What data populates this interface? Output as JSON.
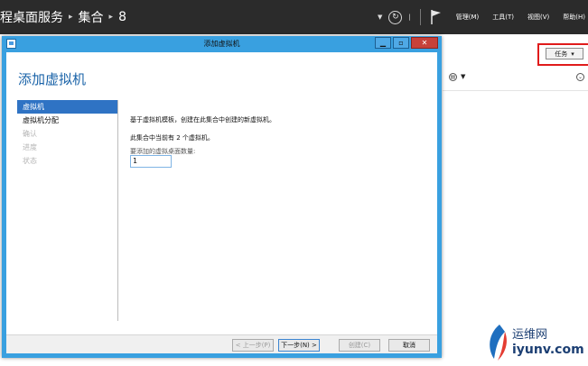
{
  "header": {
    "breadcrumb": [
      "程桌面服务",
      "集合",
      "8"
    ],
    "menus": [
      "管理(M)",
      "工具(T)",
      "视图(V)",
      "帮助(H)"
    ]
  },
  "right_panel": {
    "tasks_label": "任务"
  },
  "dialog": {
    "window_title": "添加虚拟机",
    "heading": "添加虚拟机",
    "nav": [
      {
        "label": "虚拟机",
        "state": "active"
      },
      {
        "label": "虚拟机分配",
        "state": "enabled"
      },
      {
        "label": "确认",
        "state": "disabled"
      },
      {
        "label": "进度",
        "state": "disabled"
      },
      {
        "label": "状态",
        "state": "disabled"
      }
    ],
    "content": {
      "description": "基于虚拟机模板，创建在此集合中创建的新虚拟机。",
      "current_count_text": "此集合中当前有 2 个虚拟机。",
      "quantity_label": "要添加的虚拟桌面数量:",
      "quantity_value": "1"
    },
    "buttons": {
      "prev": "< 上一步(P)",
      "next": "下一步(N) >",
      "create": "创建(C)",
      "cancel": "取消"
    }
  },
  "watermark": {
    "line1": "运维网",
    "line2": "iyunv.com"
  },
  "colors": {
    "title_bar": "#39a0e0",
    "accent_blue": "#2f73c4",
    "heading_blue": "#1a63a8",
    "highlight_red": "#e01b1b",
    "header_dark": "#2b2b2b"
  }
}
